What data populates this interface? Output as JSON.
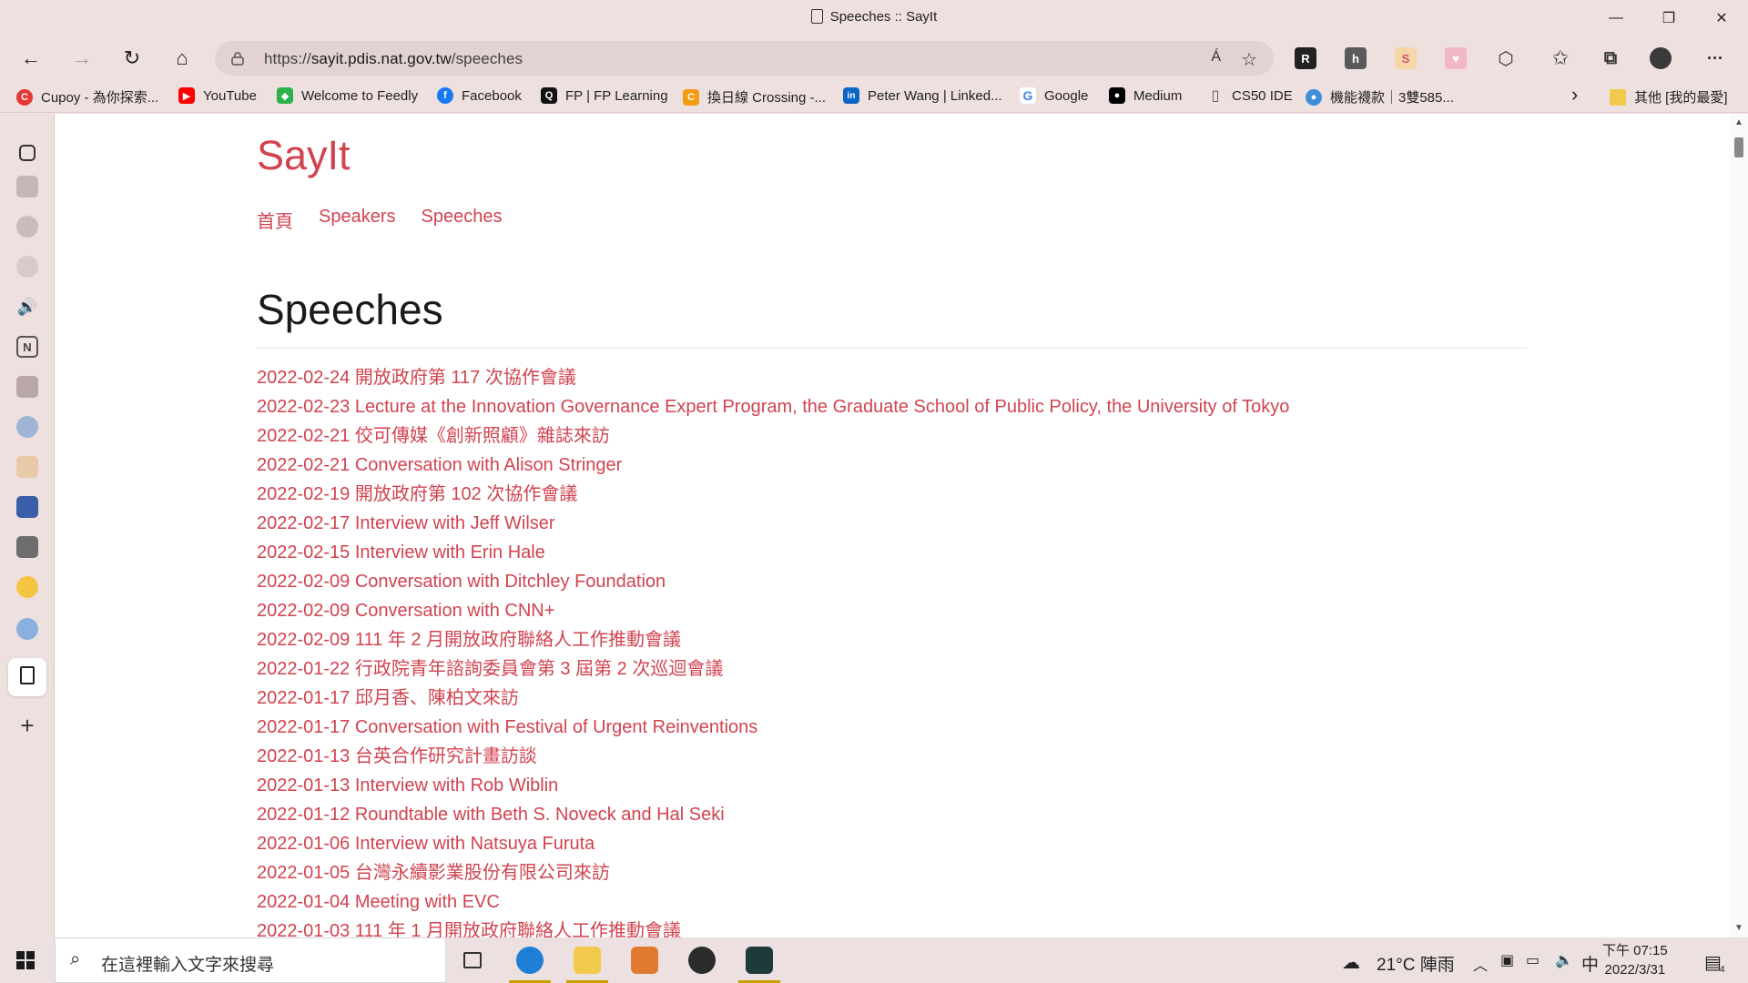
{
  "window": {
    "title": "Speeches :: SayIt",
    "min_glyph": "—",
    "max_glyph": "❐",
    "close_glyph": "✕"
  },
  "address_bar": {
    "url_scheme": "https://",
    "url_host": "sayit.pdis.nat.gov.tw",
    "url_path": "/speeches",
    "read_aloud_glyph": "Á",
    "favorite_glyph": "☆"
  },
  "nav_glyphs": {
    "back": "←",
    "forward": "→",
    "refresh": "↻",
    "home": "⌂"
  },
  "toolbar_right": {
    "favorites": "✩",
    "collections": "⧉",
    "menu": "···",
    "extensions": "⬡"
  },
  "bookmarks": [
    {
      "label": "Cupoy - 為你探索...",
      "color": "#e53935",
      "glyph": "C"
    },
    {
      "label": "YouTube",
      "color": "#ff0000",
      "glyph": "▶"
    },
    {
      "label": "Welcome to Feedly",
      "color": "#2bb24c",
      "glyph": "◆"
    },
    {
      "label": "Facebook",
      "color": "#1877f2",
      "glyph": "f"
    },
    {
      "label": "FP | FP Learning",
      "color": "#111111",
      "glyph": "Q"
    },
    {
      "label": "換日線 Crossing -...",
      "color": "#f39c12",
      "glyph": "C"
    },
    {
      "label": "Peter Wang | Linked...",
      "color": "#0a66c2",
      "glyph": "in"
    },
    {
      "label": "Google",
      "color": "#4285f4",
      "glyph": "G"
    },
    {
      "label": "Medium",
      "color": "#000000",
      "glyph": "●"
    },
    {
      "label": "CS50 IDE",
      "color": "#777777",
      "glyph": "▯"
    },
    {
      "label": "機能襪款｜3雙585...",
      "color": "#3f8ed8",
      "glyph": "●"
    }
  ],
  "bookmark_more_glyph": "›",
  "other_favorites": "其他 [我的最愛]",
  "site": {
    "brand": "SayIt",
    "nav": [
      "首頁",
      "Speakers",
      "Speeches"
    ],
    "page_title": "Speeches",
    "speeches": [
      "2022-02-24 開放政府第 117 次協作會議",
      "2022-02-23 Lecture at the Innovation Governance Expert Program, the Graduate School of Public Policy, the University of Tokyo",
      "2022-02-21 佼可傳媒《創新照顧》雜誌來訪",
      "2022-02-21 Conversation with Alison Stringer",
      "2022-02-19 開放政府第 102 次協作會議",
      "2022-02-17 Interview with Jeff Wilser",
      "2022-02-15 Interview with Erin Hale",
      "2022-02-09 Conversation with Ditchley Foundation",
      "2022-02-09 Conversation with CNN+",
      "2022-02-09 111 年 2 月開放政府聯絡人工作推動會議",
      "2022-01-22 行政院青年諮詢委員會第 3 屆第 2 次巡迴會議",
      "2022-01-17 邱月香、陳柏文來訪",
      "2022-01-17 Conversation with Festival of Urgent Reinventions",
      "2022-01-13 台英合作研究計畫訪談",
      "2022-01-13 Interview with Rob Wiblin",
      "2022-01-12 Roundtable with Beth S. Noveck and Hal Seki",
      "2022-01-06 Interview with Natsuya Furuta",
      "2022-01-05 台灣永續影業股份有限公司來訪",
      "2022-01-04 Meeting with EVC",
      "2022-01-03 111 年 1 月開放政府聯絡人工作推動會議"
    ]
  },
  "taskbar": {
    "search_placeholder": "在這裡輸入文字來搜尋",
    "weather": "21°C  陣雨",
    "ime": "中",
    "time": "下午 07:15",
    "date": "2022/3/31",
    "notification_count": "4"
  },
  "colors": {
    "link": "#d1434f",
    "chrome_bg": "#efe0e0"
  }
}
